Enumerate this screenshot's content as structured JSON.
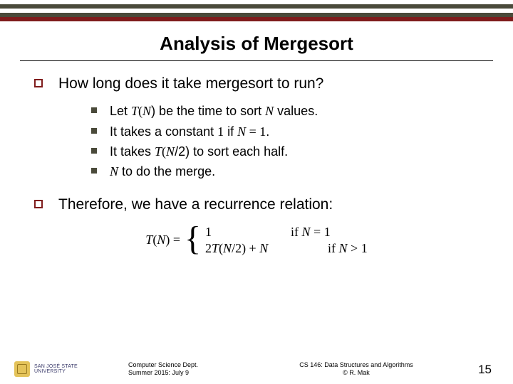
{
  "title": "Analysis of Mergesort",
  "bullets": {
    "b1": "How long does it take mergesort to run?",
    "b2": "Therefore, we have a recurrence relation:"
  },
  "sub": {
    "s1a": "Let ",
    "s1b": "T",
    "s1c": "(",
    "s1d": "N",
    "s1e": ") be the time to sort ",
    "s1f": "N",
    "s1g": " values.",
    "s2a": "It takes a constant ",
    "s2b": "1",
    "s2c": " if ",
    "s2d": "N",
    "s2e": " = ",
    "s2f": "1",
    "s2g": ".",
    "s3a": "It takes ",
    "s3b": "T",
    "s3c": "(",
    "s3d": "N",
    "s3e": "/2) to sort each half.",
    "s4a": "N",
    "s4b": " to do the merge."
  },
  "eq": {
    "lhs_T": "T",
    "lhs_open": "(",
    "lhs_N": "N",
    "lhs_close": ") = ",
    "c1_val": "1",
    "c1_if": "if ",
    "c1_N": "N",
    "c1_eq": " = 1",
    "c2_coef": "2",
    "c2_T": "T",
    "c2_open": "(",
    "c2_N": "N",
    "c2_rest": "/2) + ",
    "c2_plusN": "N",
    "c2_if": "if ",
    "c2_Nb": "N",
    "c2_gt": " > 1"
  },
  "footer": {
    "logo_line1": "SAN JOSÉ STATE",
    "logo_line2": "UNIVERSITY",
    "left1": "Computer Science Dept.",
    "left2": "Summer 2015: July 9",
    "center1": "CS 146: Data Structures and Algorithms",
    "center2": "© R. Mak",
    "page": "15"
  }
}
